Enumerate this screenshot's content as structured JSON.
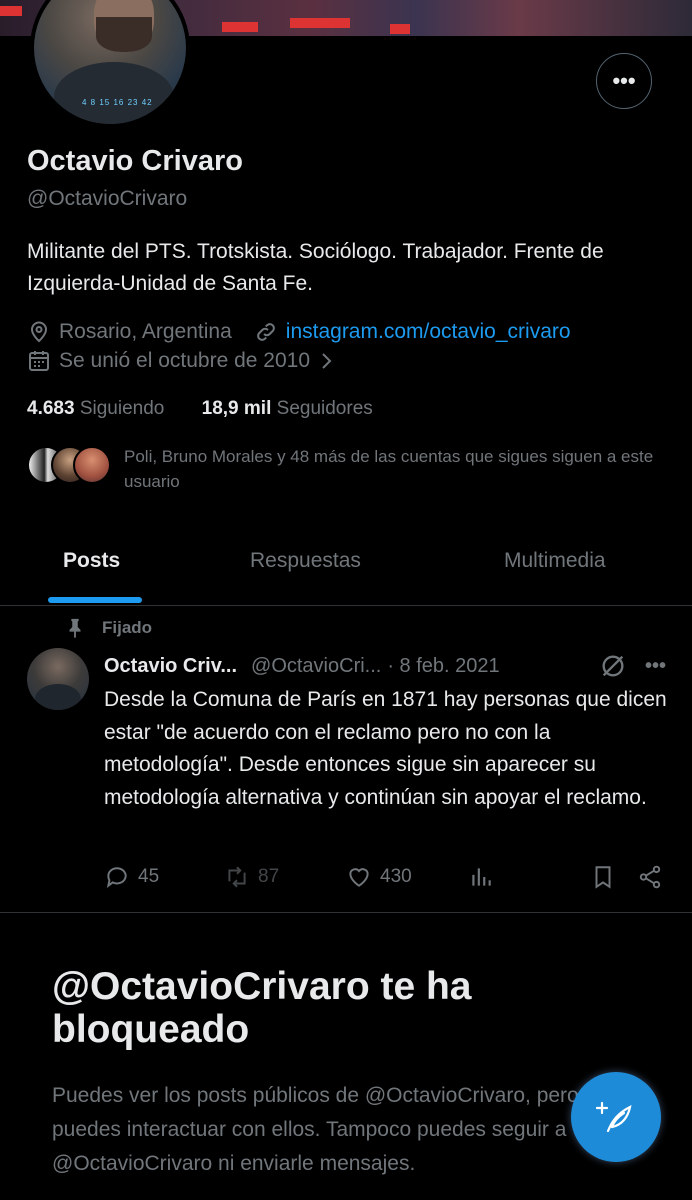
{
  "profile": {
    "name": "Octavio Crivaro",
    "handle": "@OctavioCrivaro",
    "bio": "Militante del PTS. Trotskista. Sociólogo. Trabajador. Frente de Izquierda-Unidad de Santa Fe.",
    "location": "Rosario, Argentina",
    "link": "instagram.com/octavio_crivaro",
    "joined": "Se unió el octubre de 2010",
    "following_count": "4.683",
    "following_label": "Siguiendo",
    "followers_count": "18,9 mil",
    "followers_label": "Seguidores",
    "known_followers": "Poli, Bruno Morales y 48 más de las cuentas que sigues siguen a este usuario",
    "avatar_shirt_text": "4 8 15 16 23 42"
  },
  "tabs": [
    {
      "label": "Posts",
      "active": true
    },
    {
      "label": "Respuestas",
      "active": false
    },
    {
      "label": "Multimedia",
      "active": false
    }
  ],
  "pinned_post": {
    "pinned_label": "Fijado",
    "author_name": "Octavio Criv...",
    "author_handle": "@OctavioCri...",
    "date": "· 8 feb. 2021",
    "text": "Desde la Comuna de París en 1871 hay personas que dicen estar \"de acuerdo con el reclamo pero no con la metodología\". Desde entonces sigue sin aparecer su metodología alternativa y continúan sin apoyar el reclamo.",
    "replies": "45",
    "reposts": "87",
    "likes": "430"
  },
  "blocked": {
    "title": "@OctavioCrivaro te ha bloqueado",
    "description": "Puedes ver los posts públicos de @OctavioCrivaro, pero no puedes interactuar con ellos. Tampoco puedes seguir a @OctavioCrivaro ni enviarle mensajes."
  },
  "colors": {
    "background": "#000000",
    "text": "#e7e9ea",
    "muted": "#71767b",
    "accent": "#1d9bf0",
    "divider": "#2f3336"
  },
  "icons": [
    "more-icon",
    "location-icon",
    "link-icon",
    "calendar-icon",
    "chevron-right-icon",
    "pin-icon",
    "grok-icon",
    "reply-icon",
    "repost-icon",
    "like-icon",
    "views-icon",
    "bookmark-icon",
    "share-icon",
    "compose-icon"
  ]
}
